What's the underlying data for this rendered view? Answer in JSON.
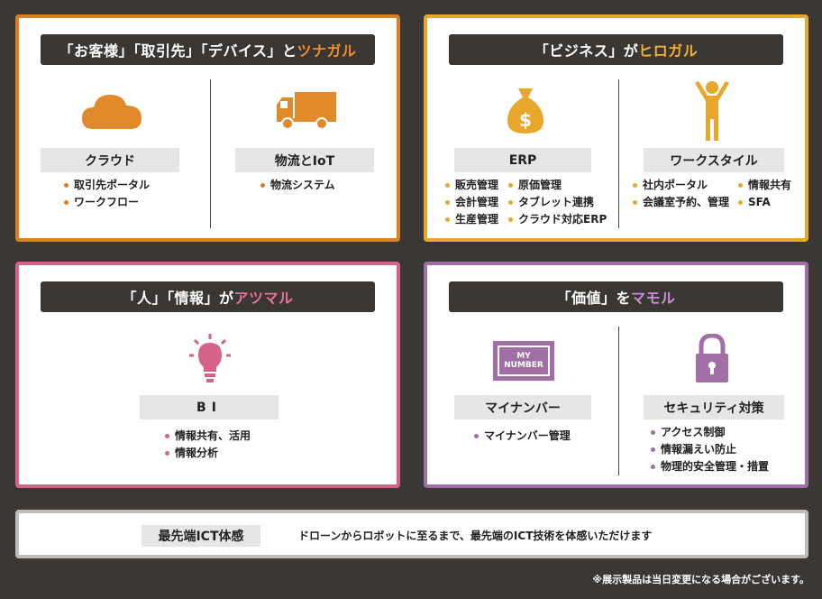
{
  "panels": {
    "p1": {
      "title_pre": "「お客様」「取引先」「デバイス」と",
      "title_hl": "ツナガル",
      "left": {
        "label": "クラウド",
        "items": [
          "取引先ポータル",
          "ワークフロー"
        ]
      },
      "right": {
        "label": "物流とIoT",
        "items": [
          "物流システム"
        ]
      },
      "accent": "#d98027"
    },
    "p2": {
      "title_pre": "「ビジネス」が",
      "title_hl": "ヒロガル",
      "left": {
        "label": "ERP",
        "col1": [
          "販売管理",
          "会計管理",
          "生産管理"
        ],
        "col2": [
          "原価管理",
          "タブレット連携",
          "クラウド対応ERP"
        ]
      },
      "right": {
        "label": "ワークスタイル",
        "col1": [
          "社内ポータル",
          "会議室予約、管理"
        ],
        "col2": [
          "情報共有",
          "SFA"
        ]
      },
      "accent": "#e6a82e"
    },
    "p3": {
      "title_pre": "「人」「情報」が",
      "title_hl": "アツマル",
      "center": {
        "label": "BI",
        "items": [
          "情報共有、活用",
          "情報分析"
        ]
      },
      "accent": "#d46387"
    },
    "p4": {
      "title_pre": "「価値」を",
      "title_hl": "マモル",
      "left": {
        "label": "マイナンバー",
        "items": [
          "マイナンバー管理"
        ],
        "badge_line1": "MY",
        "badge_line2": "NUMBER"
      },
      "right": {
        "label": "セキュリティ対策",
        "items": [
          "アクセス制御",
          "情報漏えい防止",
          "物理的安全管理・措置"
        ]
      },
      "accent": "#9f6fa6"
    }
  },
  "bottom": {
    "label": "最先端ICT体感",
    "desc": "ドローンからロボットに至るまで、最先端のICT技術を体感いただけます"
  },
  "footnote": "※展示製品は当日変更になる場合がございます。",
  "icons": {
    "cloud": "cloud-icon",
    "truck": "truck-icon",
    "money": "money-bag-icon",
    "person": "person-raising-arms-icon",
    "bulb": "lightbulb-icon",
    "badge": "my-number-badge-icon",
    "lock": "padlock-icon"
  }
}
